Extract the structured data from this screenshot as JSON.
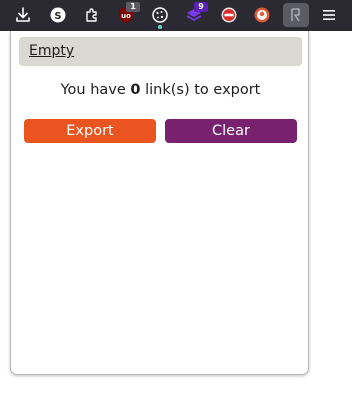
{
  "toolbar": {
    "icons": [
      {
        "name": "download-icon"
      },
      {
        "name": "skype-extension-icon"
      },
      {
        "name": "extensions-puzzle-icon"
      },
      {
        "name": "ublock-origin-icon",
        "badge": "1",
        "badge_color": "#5b5b66"
      },
      {
        "name": "cookie-icon"
      },
      {
        "name": "layers-extension-icon",
        "badge": "9",
        "badge_color": "#5b21b6"
      },
      {
        "name": "stop-sign-extension-icon"
      },
      {
        "name": "duckduckgo-icon"
      },
      {
        "name": "link-export-extension-icon"
      },
      {
        "name": "hamburger-menu-icon"
      }
    ],
    "bg_color": "#2b2a33"
  },
  "popup": {
    "empty_label": "Empty",
    "message_prefix": "You have ",
    "link_count": "0",
    "message_suffix": " link(s) to export",
    "export_label": "Export",
    "clear_label": "Clear",
    "export_color": "#e95420",
    "clear_color": "#77216f"
  }
}
